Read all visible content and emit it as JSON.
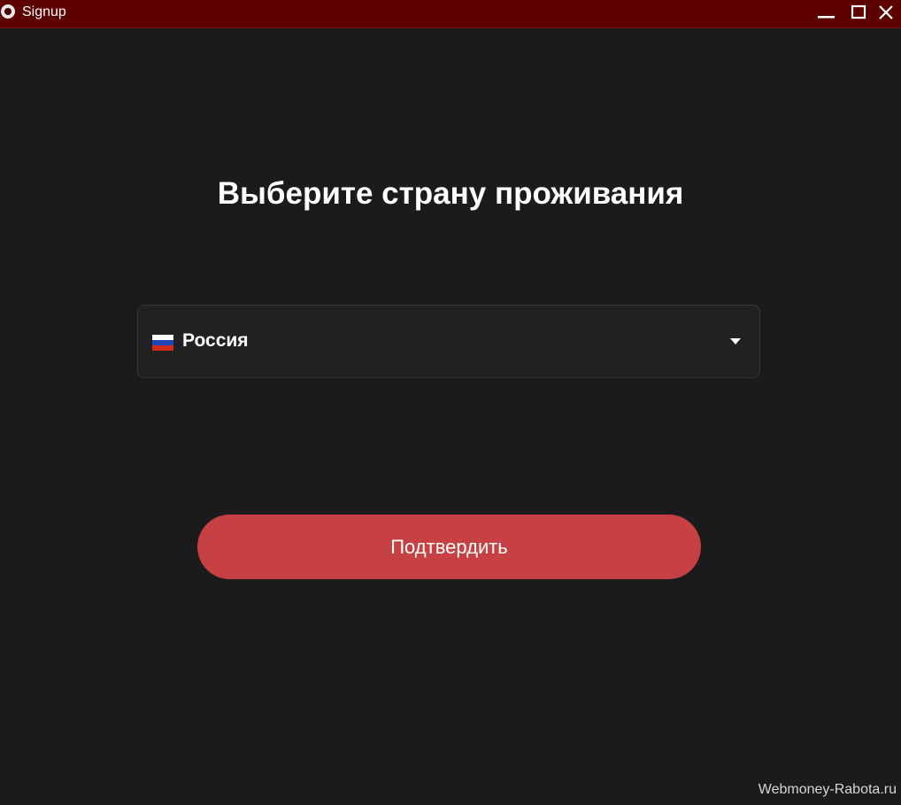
{
  "window": {
    "title": "Signup",
    "icon": "app-logo-icon",
    "controls": [
      "minimize-icon",
      "maximize-icon",
      "close-icon"
    ]
  },
  "main": {
    "heading": "Выберите страну проживания",
    "country_select": {
      "selected_value": "Россия",
      "flag_icon": "russia-flag-icon",
      "arrow_icon": "caret-down-icon"
    },
    "confirm_button": {
      "label": "Подтвердить"
    }
  },
  "watermark": "Webmoney-Rabota.ru",
  "colors": {
    "titlebar": "#5c0000",
    "background": "#1b1b1b",
    "select_background": "#212121",
    "accent_button": "#c74043",
    "text": "#ffffff",
    "flag_white": "#ffffff",
    "flag_blue": "#1f47b8",
    "flag_red": "#d52b1e"
  }
}
